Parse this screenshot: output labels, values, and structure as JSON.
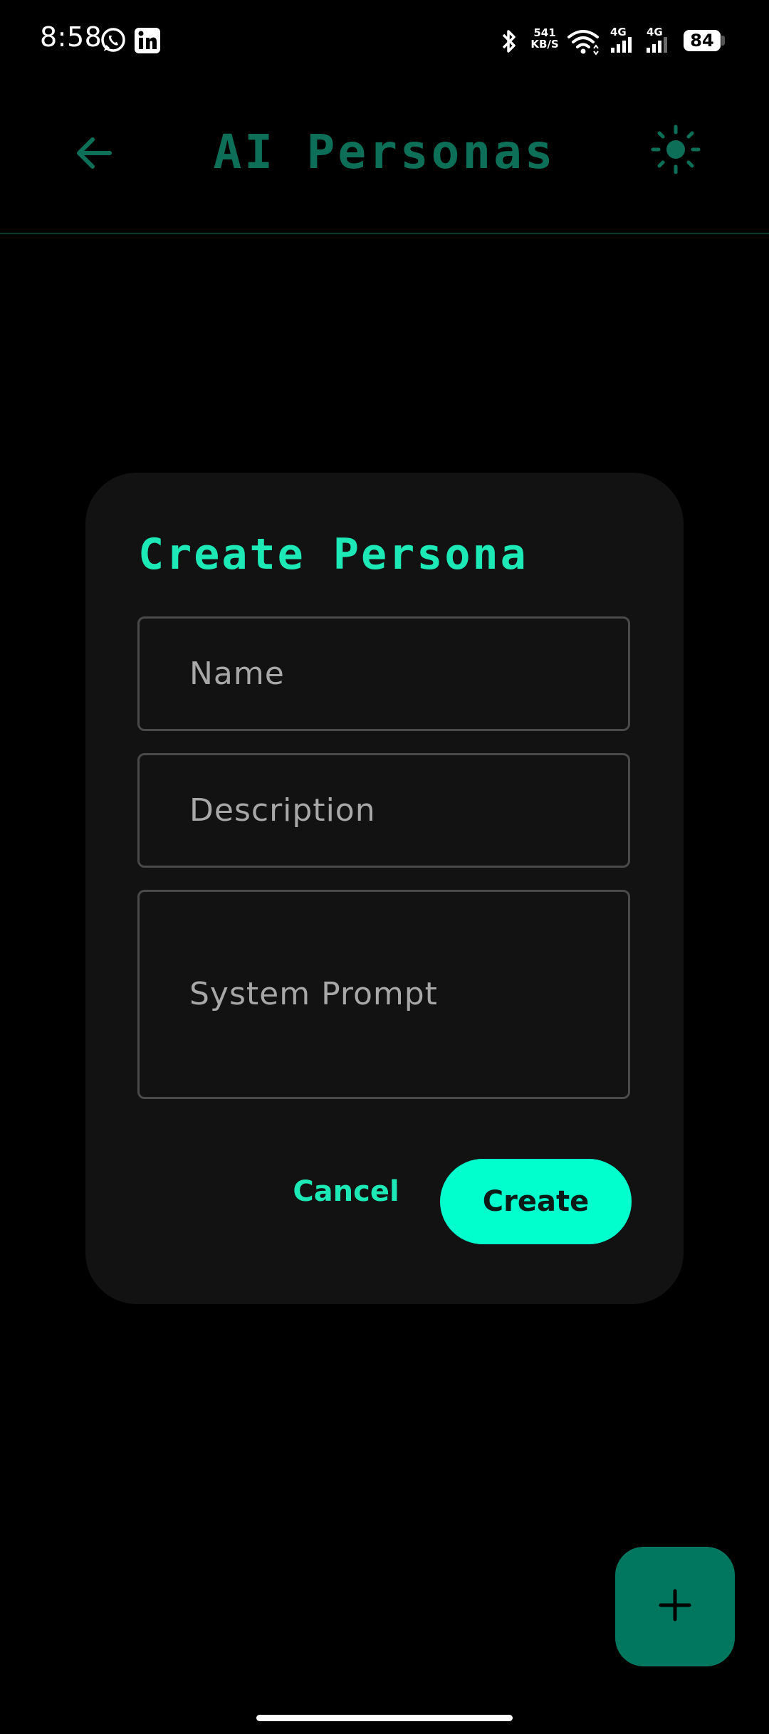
{
  "status_bar": {
    "time": "8:58",
    "net_speed_value": "541",
    "net_speed_unit": "KB/S",
    "signal_1_label": "4G",
    "signal_2_label": "4G",
    "battery_level": "84",
    "icons": [
      "whatsapp-icon",
      "linkedin-icon",
      "bluetooth-icon",
      "wifi-icon",
      "signal-icon",
      "signal-icon",
      "battery-icon"
    ]
  },
  "app_bar": {
    "title": "AI Personas",
    "back_icon": "arrow-left-icon",
    "theme_icon": "sun-icon"
  },
  "dialog": {
    "title": "Create Persona",
    "fields": {
      "name_placeholder": "Name",
      "description_placeholder": "Description",
      "system_prompt_placeholder": "System Prompt"
    },
    "cancel_label": "Cancel",
    "create_label": "Create"
  },
  "fab": {
    "icon": "plus-icon"
  },
  "colors": {
    "background": "#000000",
    "dialog_background": "#121212",
    "accent": "#1de9b6",
    "accent_bright": "#00ffcc",
    "accent_dim": "#0e6f58",
    "fab": "#00775e"
  }
}
